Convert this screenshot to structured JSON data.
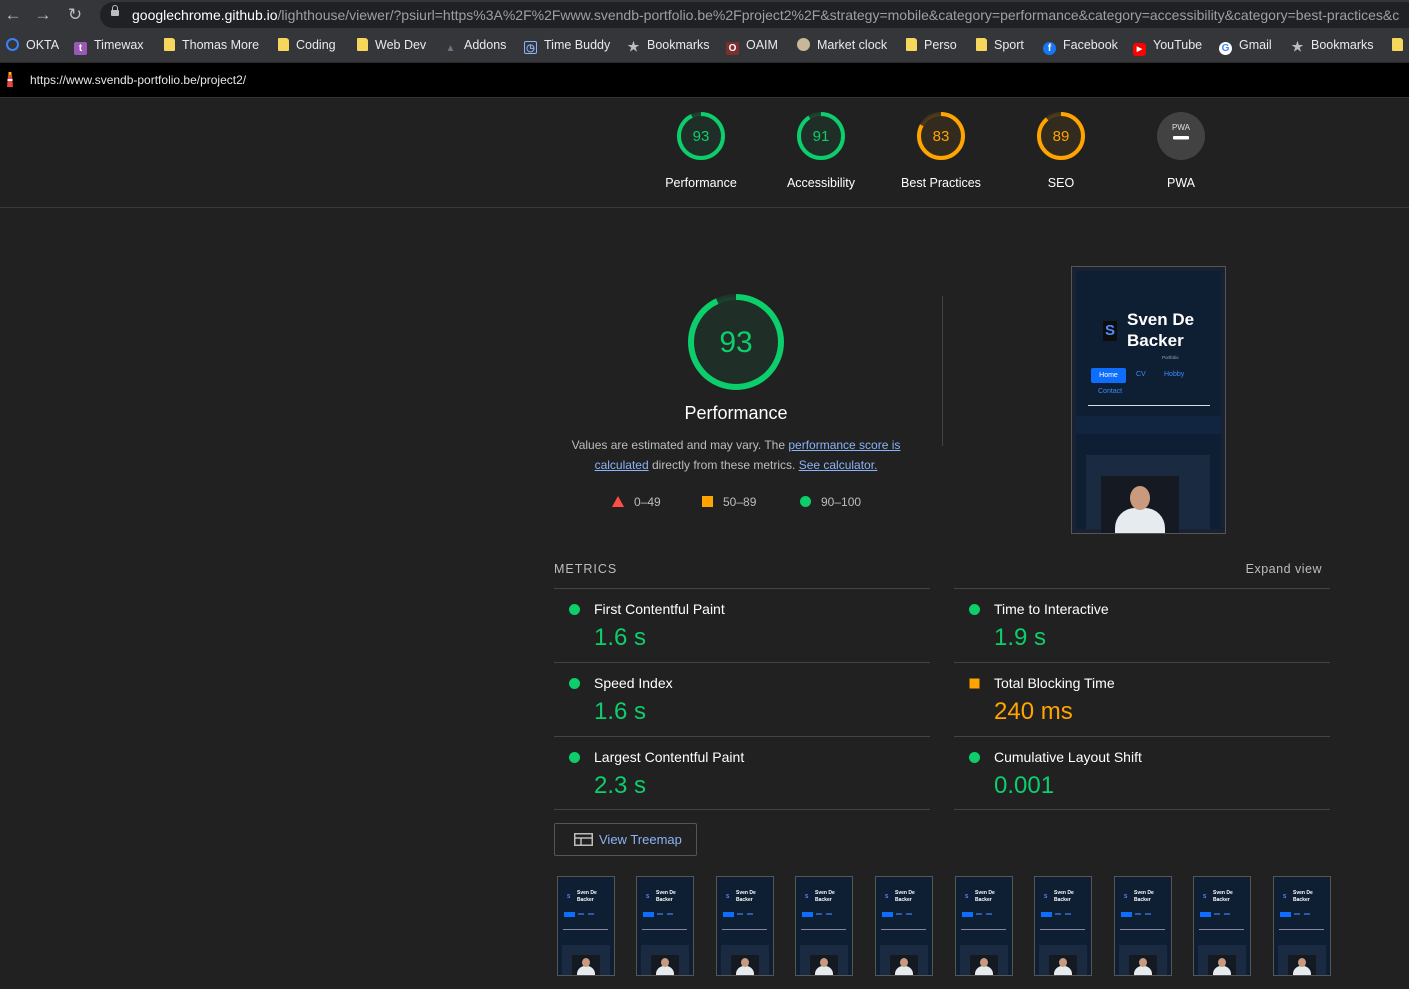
{
  "browser": {
    "url_host": "googlechrome.github.io",
    "url_rest": "/lighthouse/viewer/?psiurl=https%3A%2F%2Fwww.svendb-portfolio.be%2Fproject2%2F&strategy=mobile&category=performance&category=accessibility&category=best-practices&c",
    "bookmarks": [
      "OKTA",
      "Timewax",
      "Thomas More",
      "Coding",
      "Web Dev",
      "Addons",
      "Time Buddy",
      "Bookmarks",
      "OAIM",
      "Market clock",
      "Perso",
      "Sport",
      "Facebook",
      "YouTube",
      "Gmail",
      "Bookmarks"
    ]
  },
  "report": {
    "url": "https://www.svendb-portfolio.be/project2/"
  },
  "categories": [
    {
      "score": "93",
      "label": "Performance",
      "value": 0.93,
      "color": "#0cce6b"
    },
    {
      "score": "91",
      "label": "Accessibility",
      "value": 0.91,
      "color": "#0cce6b"
    },
    {
      "score": "83",
      "label": "Best Practices",
      "value": 0.83,
      "color": "#ffa400"
    },
    {
      "score": "89",
      "label": "SEO",
      "value": 0.89,
      "color": "#ffa400"
    },
    {
      "score": "PWA",
      "label": "PWA",
      "value": null,
      "color": "#9e9e9e"
    }
  ],
  "performance": {
    "score": "93",
    "value": 0.93,
    "title": "Performance",
    "desc_1": "Values are estimated and may vary. The ",
    "desc_link_1": "performance score is calculated",
    "desc_2": " directly from these metrics. ",
    "desc_link_2": "See calculator.",
    "legend": [
      {
        "range": "0–49",
        "color": "#ff4e42"
      },
      {
        "range": "50–89",
        "color": "#ffa400"
      },
      {
        "range": "90–100",
        "color": "#0cce6b"
      }
    ]
  },
  "screenshot": {
    "logo_letter": "S",
    "name": "Sven De\nBacker",
    "subtitle": "Portfolio",
    "nav": [
      "Home",
      "CV",
      "Hobby",
      "Contact"
    ]
  },
  "metrics": {
    "header": "METRICS",
    "expand": "Expand view",
    "items": [
      {
        "name": "First Contentful Paint",
        "value": "1.6 s",
        "status": "good"
      },
      {
        "name": "Time to Interactive",
        "value": "1.9 s",
        "status": "good"
      },
      {
        "name": "Speed Index",
        "value": "1.6 s",
        "status": "good"
      },
      {
        "name": "Total Blocking Time",
        "value": "240 ms",
        "status": "average"
      },
      {
        "name": "Largest Contentful Paint",
        "value": "2.3 s",
        "status": "good"
      },
      {
        "name": "Cumulative Layout Shift",
        "value": "0.001",
        "status": "good"
      }
    ]
  },
  "treemap_label": "View Treemap",
  "colors": {
    "good": "#0cce6b",
    "average": "#ffa400",
    "fail": "#ff4e42",
    "bg": "#212121"
  }
}
